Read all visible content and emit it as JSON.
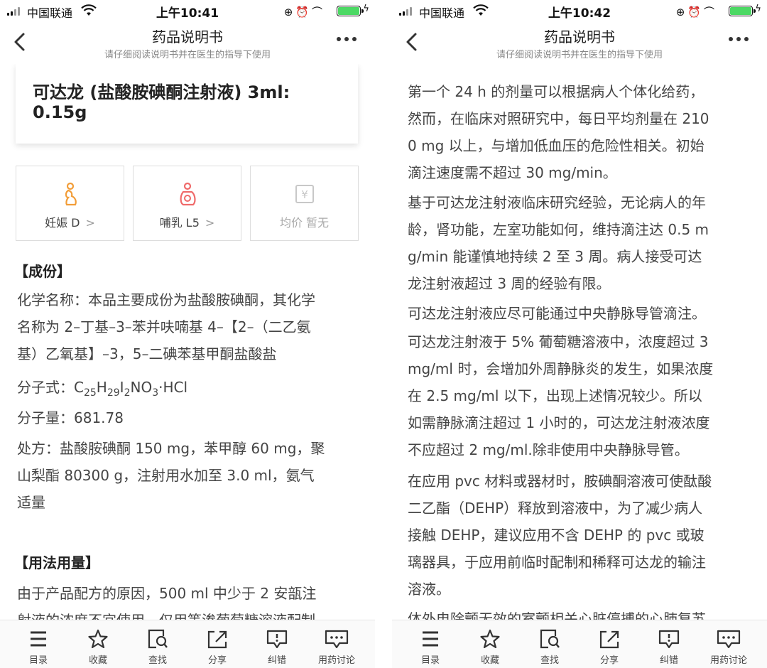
{
  "status_left": {
    "carrier": "中国联通",
    "time": "上午10:41"
  },
  "status_right": {
    "carrier": "中国联通",
    "time": "上午10:42"
  },
  "nav": {
    "title": "药品说明书",
    "subtitle": "请仔细阅读说明书并在医生的指导下使用"
  },
  "drug": {
    "name_line1": "可达龙 (盐酸胺碘酮注射液) 3ml:",
    "name_line2": "0.15g"
  },
  "tiles": [
    {
      "label": "妊娠 D",
      "chevron": ">",
      "icon": "pregnancy-icon",
      "color": "#f29d38"
    },
    {
      "label": "哺乳 L5",
      "chevron": ">",
      "icon": "breastfeeding-icon",
      "color": "#ef6a6a"
    },
    {
      "label": "均价 暂无",
      "icon": "price-icon",
      "color": "#c8c8c8"
    }
  ],
  "sections": {
    "composition_title": "【成份】",
    "chem_lines": [
      "化学名称：本品主要成份为盐酸胺碘酮，其化学",
      "名称为 2–丁基–3–苯并呋喃基 4–【2–（二乙氨",
      "基）乙氧基】–3，5–二碘苯基甲酮盐酸盐"
    ],
    "formula_label": "分子式：",
    "formula_parts": [
      "C",
      "25",
      "H",
      "29",
      "I",
      "2",
      "NO",
      "3",
      "·HCl"
    ],
    "mw": "分子量：681.78",
    "recipe_lines": [
      "处方：盐酸胺碘酮 150 mg，苯甲醇 60 mg，聚",
      "山梨酯 80300 g，注射用水加至 3.0 ml，氨气",
      "适量"
    ],
    "usage_title": "【用法用量】",
    "usage_lines": [
      "由于产品配方的原因，500 ml 中少于 2 安瓿注",
      "射液的浓度不宜使用，仅用等渗葡萄糖溶液配制"
    ]
  },
  "right_text": {
    "top_fragment": "。",
    "p1": [
      "第一个 24 h 的剂量可以根据病人个体化给药，",
      "然而，在临床对照研究中，每日平均剂量在 210",
      "0 mg 以上，与增加低血压的危险性相关。初始",
      "滴注速度需不超过 30 mg/min。"
    ],
    "p2": [
      "基于可达龙注射液临床研究经验，无论病人的年",
      "龄，肾功能，左室功能如何，维持滴注达 0.5 m",
      "g/min 能谨慎地持续 2 至 3 周。病人接受可达",
      "龙注射液超过 3 周的经验有限。"
    ],
    "p3": [
      "可达龙注射液应尽可能通过中央静脉导管滴注。"
    ],
    "p4": [
      "可达龙注射液于 5% 葡萄糖溶液中，浓度超过 3",
      "mg/ml 时，会增加外周静脉炎的发生，如果浓度",
      "在 2.5 mg/ml 以下，出现上述情况较少。所以",
      "如需静脉滴注超过 1 小时的，可达龙注射液浓度",
      "不应超过 2 mg/ml.除非使用中央静脉导管。"
    ],
    "p5": [
      "在应用 pvc 材料或器材时，胺碘酮溶液可使酞酸",
      "二乙酯（DEHP）释放到溶液中，为了减少病人",
      "接触 DEHP，建议应用不含 DEHP 的 pvc 或玻",
      "璃器具，于应用前临时配制和稀释可达龙的输注",
      "溶液。"
    ],
    "p6": [
      "体外电除颤无效的室颤相关心脏停搏的心肺复苏"
    ]
  },
  "tabbar": [
    {
      "label": "目录",
      "icon": "menu-icon"
    },
    {
      "label": "收藏",
      "icon": "star-icon"
    },
    {
      "label": "查找",
      "icon": "search-doc-icon"
    },
    {
      "label": "分享",
      "icon": "share-icon"
    },
    {
      "label": "纠错",
      "icon": "report-error-icon"
    },
    {
      "label": "用药讨论",
      "icon": "discussion-icon"
    }
  ]
}
